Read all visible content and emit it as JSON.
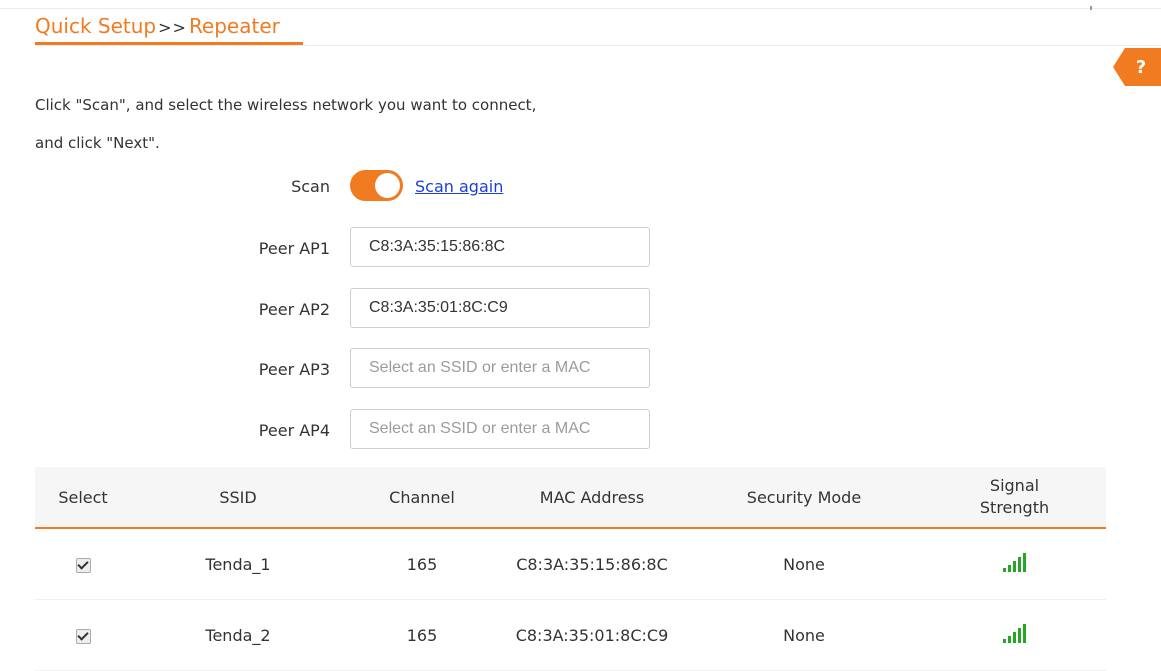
{
  "breadcrumb": {
    "root": "Quick Setup",
    "separator": ">>",
    "current": "Repeater"
  },
  "help": {
    "icon": "help-icon",
    "label": "?"
  },
  "instructions": {
    "line1": "Click \"Scan\", and select the wireless network you want to connect,",
    "line2": "and click \"Next\"."
  },
  "scan": {
    "label": "Scan",
    "toggle_on": true,
    "link": "Scan again"
  },
  "peers": [
    {
      "label": "Peer AP1",
      "value": "C8:3A:35:15:86:8C",
      "placeholder": "Select an SSID or enter a MAC"
    },
    {
      "label": "Peer AP2",
      "value": "C8:3A:35:01:8C:C9",
      "placeholder": "Select an SSID or enter a MAC"
    },
    {
      "label": "Peer AP3",
      "value": "",
      "placeholder": "Select an SSID or enter a MAC"
    },
    {
      "label": "Peer AP4",
      "value": "",
      "placeholder": "Select an SSID or enter a MAC"
    }
  ],
  "table": {
    "headers": {
      "select": "Select",
      "ssid": "SSID",
      "channel": "Channel",
      "mac": "MAC Address",
      "security": "Security Mode",
      "signal1": "Signal",
      "signal2": "Strength"
    },
    "rows": [
      {
        "checked": true,
        "ssid": "Tenda_1",
        "channel": "165",
        "mac": "C8:3A:35:15:86:8C",
        "security": "None",
        "signal_icon": "signal-strength-icon"
      },
      {
        "checked": true,
        "ssid": "Tenda_2",
        "channel": "165",
        "mac": "C8:3A:35:01:8C:C9",
        "security": "None",
        "signal_icon": "signal-strength-icon"
      }
    ]
  },
  "colors": {
    "accent": "#f07b21",
    "link": "#1a3fd8",
    "signal": "#26a626"
  }
}
